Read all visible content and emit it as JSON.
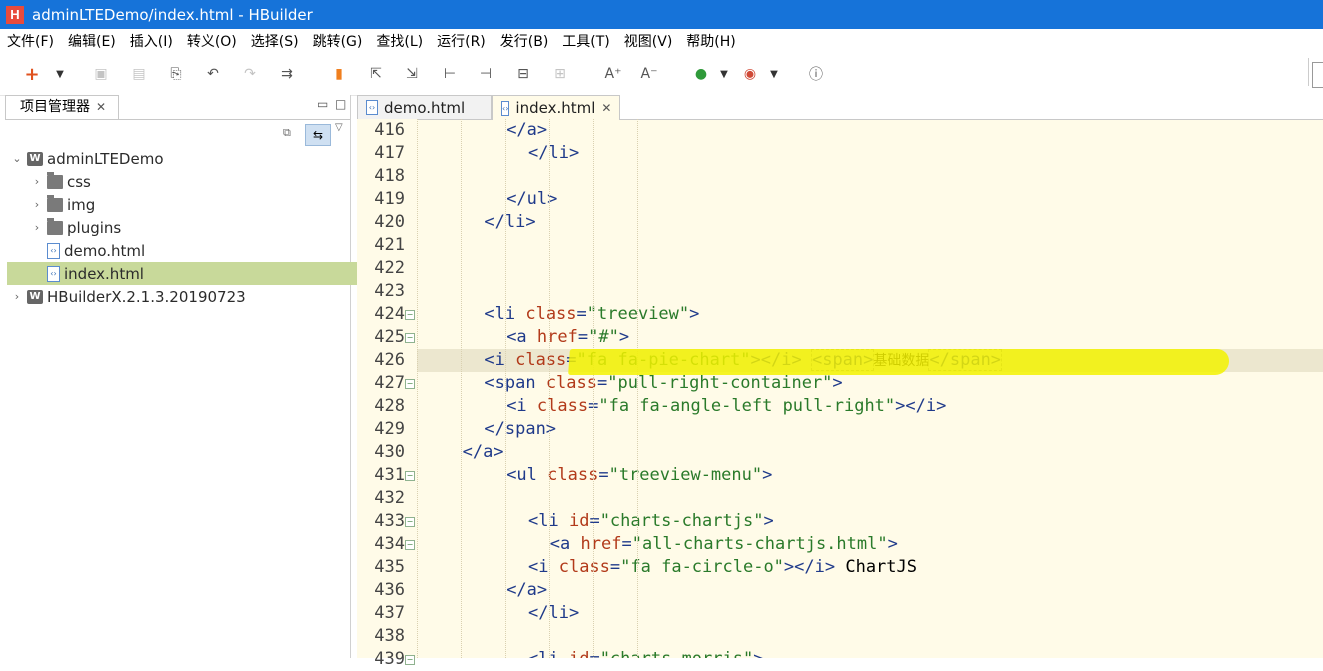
{
  "window": {
    "logo": "H",
    "title": "adminLTEDemo/index.html  -  HBuilder"
  },
  "menu": [
    "文件(F)",
    "编辑(E)",
    "插入(I)",
    "转义(O)",
    "选择(S)",
    "跳转(G)",
    "查找(L)",
    "运行(R)",
    "发行(B)",
    "工具(T)",
    "视图(V)",
    "帮助(H)"
  ],
  "toolbar": {
    "icons": [
      "add-icon",
      "dropdown-caret-icon",
      "save-icon",
      "save-all-icon",
      "revert-icon",
      "undo-icon",
      "redo-icon",
      "format-icon",
      "bookmark-icon",
      "prev-edit-icon",
      "next-edit-icon",
      "go-start-icon",
      "go-end-icon",
      "split-icon",
      "merge-icon",
      "font-increase-icon",
      "font-decrease-icon",
      "run-icon",
      "run-caret-icon",
      "browser-icon",
      "browser-caret-icon",
      "info-icon"
    ]
  },
  "project_panel": {
    "tab_label": "项目管理器",
    "tree": [
      {
        "label": "adminLTEDemo",
        "level": 0,
        "kind": "project",
        "expanded": true,
        "selected": false
      },
      {
        "label": "css",
        "level": 1,
        "kind": "folder",
        "expanded": false,
        "selected": false
      },
      {
        "label": "img",
        "level": 1,
        "kind": "folder",
        "expanded": false,
        "selected": false
      },
      {
        "label": "plugins",
        "level": 1,
        "kind": "folder",
        "expanded": false,
        "selected": false
      },
      {
        "label": "demo.html",
        "level": 1,
        "kind": "file",
        "selected": false
      },
      {
        "label": "index.html",
        "level": 1,
        "kind": "file",
        "selected": true
      },
      {
        "label": "HBuilderX.2.1.3.20190723",
        "level": 0,
        "kind": "project",
        "expanded": false,
        "selected": false
      }
    ]
  },
  "editor": {
    "tabs": [
      {
        "label": "demo.html",
        "active": false
      },
      {
        "label": "index.html",
        "active": true
      }
    ],
    "current_line": 426,
    "lines": [
      {
        "n": "416",
        "fold": false,
        "indent": 8,
        "tokens": [
          [
            "tag",
            "</a>"
          ]
        ]
      },
      {
        "n": "417",
        "fold": false,
        "indent": 10,
        "tokens": [
          [
            "tag",
            "</li>"
          ]
        ]
      },
      {
        "n": "418",
        "fold": false,
        "indent": 0,
        "tokens": []
      },
      {
        "n": "419",
        "fold": false,
        "indent": 8,
        "tokens": [
          [
            "tag",
            "</ul>"
          ]
        ]
      },
      {
        "n": "420",
        "fold": false,
        "indent": 6,
        "tokens": [
          [
            "tag",
            "</li>"
          ]
        ]
      },
      {
        "n": "421",
        "fold": false,
        "indent": 0,
        "tokens": []
      },
      {
        "n": "422",
        "fold": false,
        "indent": 0,
        "tokens": []
      },
      {
        "n": "423",
        "fold": false,
        "indent": 0,
        "tokens": []
      },
      {
        "n": "424",
        "fold": true,
        "indent": 6,
        "tokens": [
          [
            "tag",
            "<li "
          ],
          [
            "attr",
            "class"
          ],
          [
            "tag",
            "="
          ],
          [
            "str",
            "\"treeview\""
          ],
          [
            "tag",
            ">"
          ]
        ]
      },
      {
        "n": "425",
        "fold": true,
        "indent": 8,
        "tokens": [
          [
            "tag",
            "<a "
          ],
          [
            "attr",
            "href"
          ],
          [
            "tag",
            "="
          ],
          [
            "str",
            "\"#\""
          ],
          [
            "tag",
            ">"
          ]
        ]
      },
      {
        "n": "426",
        "fold": false,
        "indent": 6,
        "tokens": [
          [
            "tag",
            "<i "
          ],
          [
            "attr",
            "class"
          ],
          [
            "tag",
            "="
          ],
          [
            "str",
            "\"fa fa-pie-chart\""
          ],
          [
            "tag",
            "></i> "
          ],
          [
            "tagbox",
            "<span>"
          ],
          [
            "cn",
            "基础数据"
          ],
          [
            "tagbox",
            "</span>"
          ]
        ]
      },
      {
        "n": "427",
        "fold": true,
        "indent": 6,
        "tokens": [
          [
            "tag",
            "<span "
          ],
          [
            "attr",
            "class"
          ],
          [
            "tag",
            "="
          ],
          [
            "str",
            "\"pull-right-container\""
          ],
          [
            "tag",
            ">"
          ]
        ]
      },
      {
        "n": "428",
        "fold": false,
        "indent": 8,
        "tokens": [
          [
            "tag",
            "<i "
          ],
          [
            "attr",
            "class"
          ],
          [
            "tag",
            "="
          ],
          [
            "str",
            "\"fa fa-angle-left pull-right\""
          ],
          [
            "tag",
            "></i>"
          ]
        ]
      },
      {
        "n": "429",
        "fold": false,
        "indent": 6,
        "tokens": [
          [
            "tag",
            "</span>"
          ]
        ]
      },
      {
        "n": "430",
        "fold": false,
        "indent": 4,
        "tokens": [
          [
            "tag",
            "</a>"
          ]
        ]
      },
      {
        "n": "431",
        "fold": true,
        "indent": 8,
        "tokens": [
          [
            "tag",
            "<ul "
          ],
          [
            "attr",
            "class"
          ],
          [
            "tag",
            "="
          ],
          [
            "str",
            "\"treeview-menu\""
          ],
          [
            "tag",
            ">"
          ]
        ]
      },
      {
        "n": "432",
        "fold": false,
        "indent": 0,
        "tokens": []
      },
      {
        "n": "433",
        "fold": true,
        "indent": 10,
        "tokens": [
          [
            "tag",
            "<li "
          ],
          [
            "attr",
            "id"
          ],
          [
            "tag",
            "="
          ],
          [
            "str",
            "\"charts-chartjs\""
          ],
          [
            "tag",
            ">"
          ]
        ]
      },
      {
        "n": "434",
        "fold": true,
        "indent": 12,
        "tokens": [
          [
            "tag",
            "<a "
          ],
          [
            "attr",
            "href"
          ],
          [
            "tag",
            "="
          ],
          [
            "str",
            "\"all-charts-chartjs.html\""
          ],
          [
            "tag",
            ">"
          ]
        ]
      },
      {
        "n": "435",
        "fold": false,
        "indent": 10,
        "tokens": [
          [
            "tag",
            "<i "
          ],
          [
            "attr",
            "class"
          ],
          [
            "tag",
            "="
          ],
          [
            "str",
            "\"fa fa-circle-o\""
          ],
          [
            "tag",
            "></i> "
          ],
          [
            "plain",
            "ChartJS"
          ]
        ]
      },
      {
        "n": "436",
        "fold": false,
        "indent": 8,
        "tokens": [
          [
            "tag",
            "</a>"
          ]
        ]
      },
      {
        "n": "437",
        "fold": false,
        "indent": 10,
        "tokens": [
          [
            "tag",
            "</li>"
          ]
        ]
      },
      {
        "n": "438",
        "fold": false,
        "indent": 0,
        "tokens": []
      },
      {
        "n": "439",
        "fold": true,
        "indent": 10,
        "tokens": [
          [
            "tag",
            "<li "
          ],
          [
            "attr",
            "id"
          ],
          [
            "tag",
            "="
          ],
          [
            "str",
            "\"charts-morris\""
          ],
          [
            "tag",
            ">"
          ]
        ]
      }
    ]
  },
  "colors": {
    "titlebar": "#1673d9",
    "editor_bg": "#fffbe8",
    "tree_selection": "#c8d99a",
    "highlight": "#f3f200",
    "tag": "#1f3a8a",
    "attr": "#b23a1a",
    "string": "#2a7a2a"
  }
}
